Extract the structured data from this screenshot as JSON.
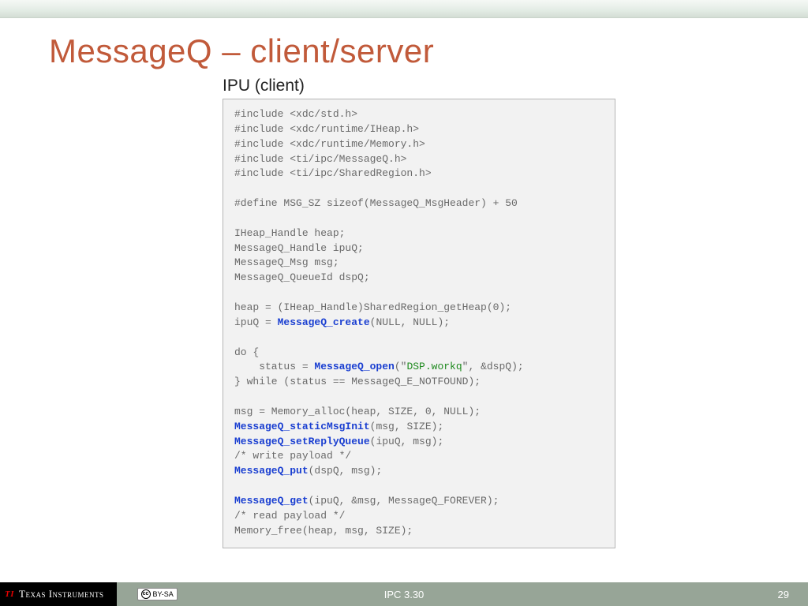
{
  "title": "MessageQ – client/server",
  "subhead": "IPU (client)",
  "code": {
    "l1": "#include <xdc/std.h>",
    "l2": "#include <xdc/runtime/IHeap.h>",
    "l3": "#include <xdc/runtime/Memory.h>",
    "l4": "#include <ti/ipc/MessageQ.h>",
    "l5": "#include <ti/ipc/SharedRegion.h>",
    "l6": "#define MSG_SZ sizeof(MessageQ_MsgHeader) + 50",
    "l7": "IHeap_Handle heap;",
    "l8": "MessageQ_Handle ipuQ;",
    "l9": "MessageQ_Msg msg;",
    "l10": "MessageQ_QueueId dspQ;",
    "l11": "heap = (IHeap_Handle)SharedRegion_getHeap(0);",
    "l12a": "ipuQ = ",
    "l12b": "MessageQ_create",
    "l12c": "(NULL, NULL);",
    "l13": "do {",
    "l14a": "    status = ",
    "l14b": "MessageQ_open",
    "l14c": "(\"",
    "l14d": "DSP.workq",
    "l14e": "\", &dspQ);",
    "l15": "} while (status == MessageQ_E_NOTFOUND);",
    "l16": "msg = Memory_alloc(heap, SIZE, 0, NULL);",
    "l17a": "MessageQ_staticMsgInit",
    "l17b": "(msg, SIZE);",
    "l18a": "MessageQ_setReplyQueue",
    "l18b": "(ipuQ, msg);",
    "l19": "/* write payload */",
    "l20a": "MessageQ_put",
    "l20b": "(dspQ, msg);",
    "l21a": "MessageQ_get",
    "l21b": "(ipuQ, &msg, MessageQ_FOREVER);",
    "l22": "/* read payload */",
    "l23": "Memory_free(heap, msg, SIZE);"
  },
  "footer": {
    "company": "Texas Instruments",
    "license": "BY-SA",
    "center": "IPC 3.30",
    "page": "29"
  }
}
